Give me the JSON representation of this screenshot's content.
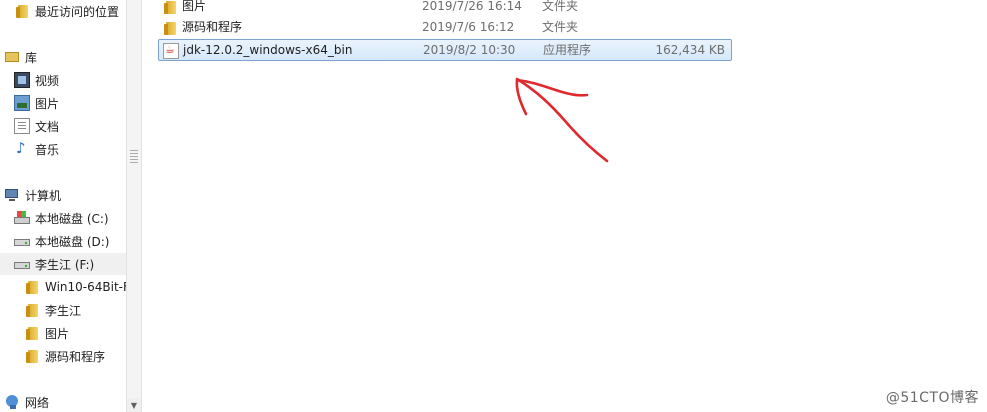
{
  "navigation": {
    "quick_access": {
      "recent_places": "最近访问的位置"
    },
    "libraries": {
      "label": "库",
      "items": [
        {
          "label": "视频",
          "icon": "video-icon"
        },
        {
          "label": "图片",
          "icon": "picture-icon"
        },
        {
          "label": "文档",
          "icon": "document-icon"
        },
        {
          "label": "音乐",
          "icon": "music-icon"
        }
      ]
    },
    "computer": {
      "label": "计算机",
      "drives": [
        {
          "label": "本地磁盘 (C:)",
          "icon": "system-drive-icon"
        },
        {
          "label": "本地磁盘 (D:)",
          "icon": "drive-icon"
        },
        {
          "label": "李生江 (F:)",
          "icon": "drive-icon",
          "selected": true
        }
      ],
      "subfolders": [
        {
          "label": "Win10-64Bit-F"
        },
        {
          "label": "李生江"
        },
        {
          "label": "图片"
        },
        {
          "label": "源码和程序"
        }
      ]
    },
    "network": {
      "label": "网络"
    }
  },
  "files": [
    {
      "name": "图片",
      "date": "2019/7/26 16:14",
      "type": "文件夹",
      "size": "",
      "icon": "folder-icon"
    },
    {
      "name": "源码和程序",
      "date": "2019/7/6 16:12",
      "type": "文件夹",
      "size": "",
      "icon": "folder-icon"
    },
    {
      "name": "jdk-12.0.2_windows-x64_bin",
      "date": "2019/8/2 10:30",
      "type": "应用程序",
      "size": "162,434 KB",
      "icon": "java-installer-icon",
      "selected": true
    }
  ],
  "watermark": "@51CTO博客",
  "colors": {
    "selection_border": "#7da2ce",
    "annotation": "#e0282e"
  }
}
